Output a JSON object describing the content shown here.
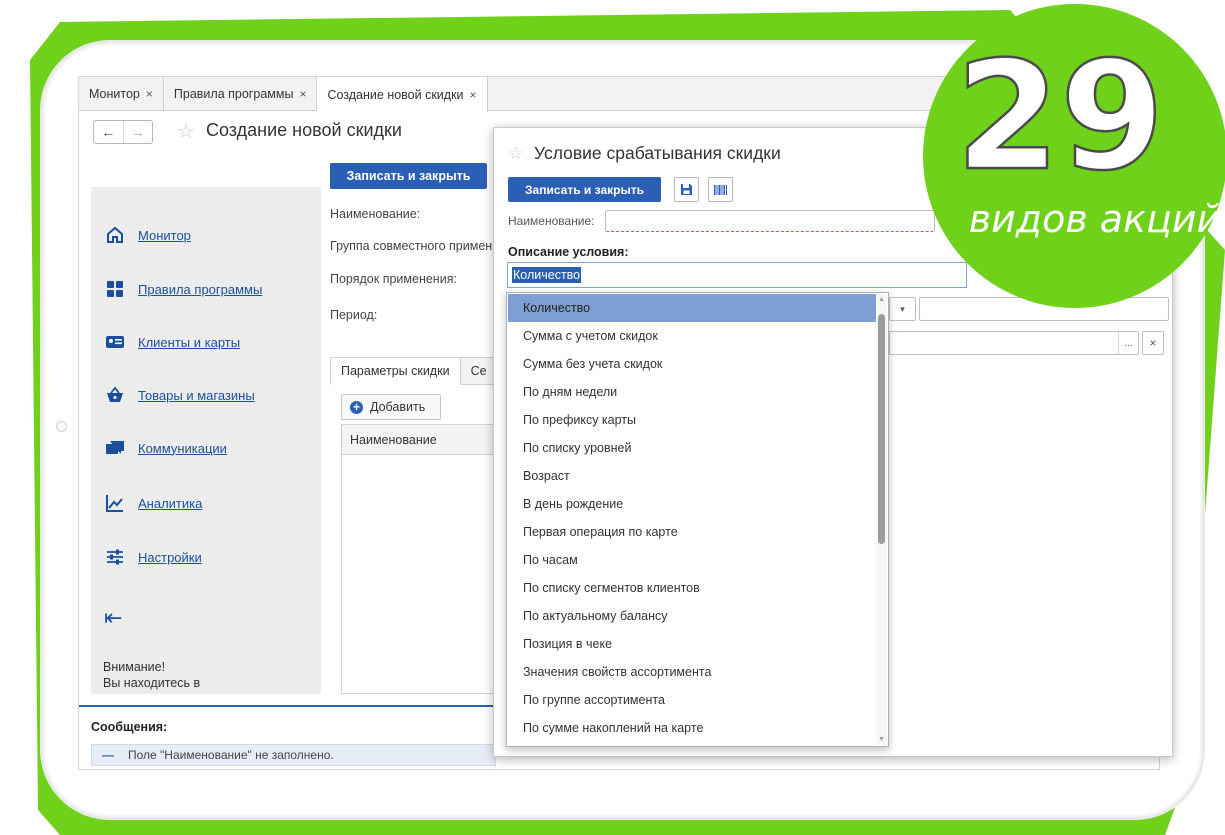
{
  "tabs": [
    {
      "label": "Монитор",
      "close": "×"
    },
    {
      "label": "Правила программы",
      "close": "×"
    },
    {
      "label": "Создание новой скидки",
      "close": "×"
    }
  ],
  "nav": {
    "back": "←",
    "forward": "→"
  },
  "page": {
    "title": "Создание новой скидки"
  },
  "sidebar": {
    "items": [
      {
        "label": "Монитор",
        "icon": "home-icon"
      },
      {
        "label": "Правила программы",
        "icon": "grid-icon"
      },
      {
        "label": "Клиенты и карты",
        "icon": "id-card-icon"
      },
      {
        "label": "Товары и магазины",
        "icon": "basket-icon"
      },
      {
        "label": "Коммуникации",
        "icon": "chat-icon"
      },
      {
        "label": "Аналитика",
        "icon": "chart-icon"
      },
      {
        "label": "Настройки",
        "icon": "sliders-icon"
      }
    ],
    "collapse": "⇤",
    "warning_line1": "Внимание!",
    "warning_line2": "Вы находитесь в"
  },
  "main": {
    "save_close": "Записать и закрыть",
    "fields": [
      "Наименование:",
      "Группа совместного примен",
      "Порядок применения:",
      "Период:"
    ],
    "tabs": [
      "Параметры скидки",
      "Се"
    ],
    "add_button": "Добавить",
    "column_name": "Наименование"
  },
  "messages": {
    "title": "Сообщения:",
    "dash": "—",
    "text": "Поле \"Наименование\" не заполнено."
  },
  "dialog": {
    "title": "Условие срабатывания скидки",
    "save_close": "Записать и закрыть",
    "name_label": "Наименование:",
    "description_label": "Описание условия:",
    "combo_value": "Количество",
    "dots": "...",
    "clear": "×"
  },
  "dropdown": {
    "items": [
      "Количество",
      "Сумма с учетом скидок",
      "Сумма без учета скидок",
      "По дням недели",
      "По префиксу карты",
      "По списку уровней",
      "Возраст",
      "В день рождение",
      "Первая операция по карте",
      "По часам",
      "По списку сегментов клиентов",
      "По актуальному балансу",
      "Позиция в чеке",
      "Значения свойств ассортимента",
      "По группе ассортимента",
      "По сумме накоплений на карте"
    ],
    "selected": 0
  },
  "badge": {
    "number": "29",
    "caption": "видов акций"
  },
  "colors": {
    "brand_green": "#6fd11a",
    "primary_blue": "#2a5fb4",
    "link_blue": "#1b4f9e",
    "selection": "#7e9fd1"
  }
}
